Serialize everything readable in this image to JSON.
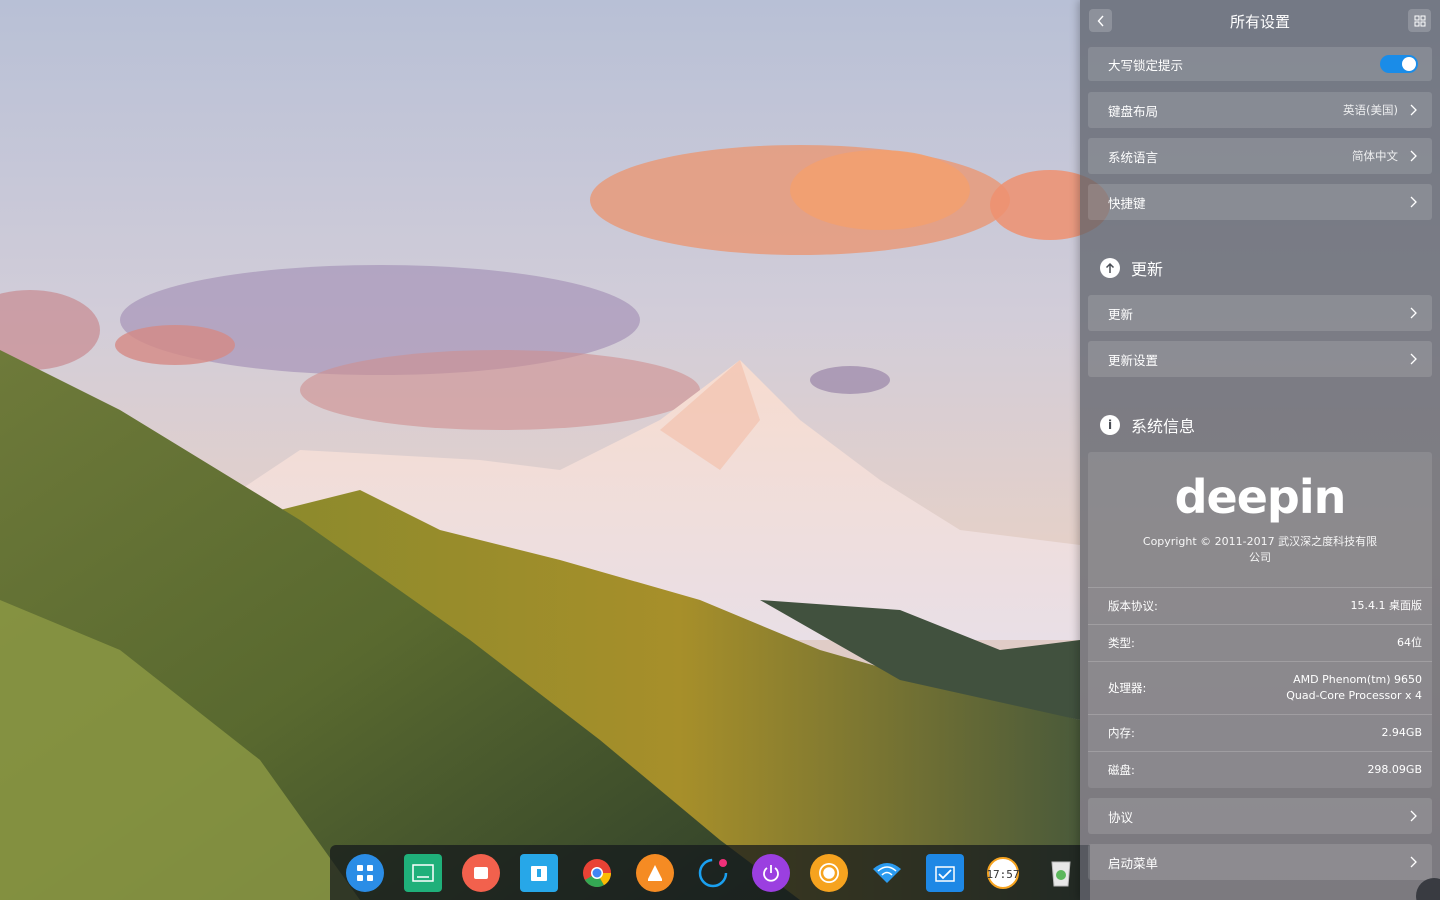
{
  "settings": {
    "title": "所有设置",
    "rows_top": [
      {
        "label": "大写锁定提示",
        "type": "toggle",
        "on": true
      },
      {
        "label": "键盘布局",
        "value": "英语(美国)"
      },
      {
        "label": "系统语言",
        "value": "简体中文"
      },
      {
        "label": "快捷键",
        "value": ""
      }
    ],
    "update_section": {
      "title": "更新",
      "rows": [
        {
          "label": "更新"
        },
        {
          "label": "更新设置"
        }
      ]
    },
    "sysinfo_section": {
      "title": "系统信息",
      "logo_text": "deepin",
      "copyright": "Copyright © 2011-2017 武汉深之度科技有限公司",
      "items": [
        {
          "key": "版本协议:",
          "value": "15.4.1 桌面版"
        },
        {
          "key": "类型:",
          "value": "64位"
        },
        {
          "key": "处理器:",
          "value": "AMD Phenom(tm) 9650 Quad-Core Processor x 4"
        },
        {
          "key": "内存:",
          "value": "2.94GB"
        },
        {
          "key": "磁盘:",
          "value": "298.09GB"
        }
      ]
    },
    "rows_bottom": [
      {
        "label": "协议"
      },
      {
        "label": "启动菜单"
      }
    ]
  },
  "dock": {
    "items": [
      {
        "icon": "launcher-icon",
        "color": "#2b8de6"
      },
      {
        "icon": "terminal-icon",
        "color": "#1fb07a"
      },
      {
        "icon": "screen-recorder-icon",
        "color": "#f2614d"
      },
      {
        "icon": "file-manager-icon",
        "color": "#27a7e8"
      },
      {
        "icon": "chrome-icon",
        "color": "#e94235"
      },
      {
        "icon": "vlc-icon",
        "color": "#f58b23"
      },
      {
        "icon": "deepin-store-icon",
        "color": "#1aa0f0"
      },
      {
        "icon": "shutdown-icon",
        "color": "#9b3fe0"
      },
      {
        "icon": "music-player-icon",
        "color": "#f6a31f"
      },
      {
        "icon": "network-icon",
        "color": "#2b9bf0"
      },
      {
        "icon": "system-monitor-icon",
        "color": "#1e88e5"
      },
      {
        "icon": "clock-icon",
        "color": "#ffffff",
        "text": "17:57"
      },
      {
        "icon": "trash-icon",
        "color": "#e8e8e8"
      }
    ]
  }
}
